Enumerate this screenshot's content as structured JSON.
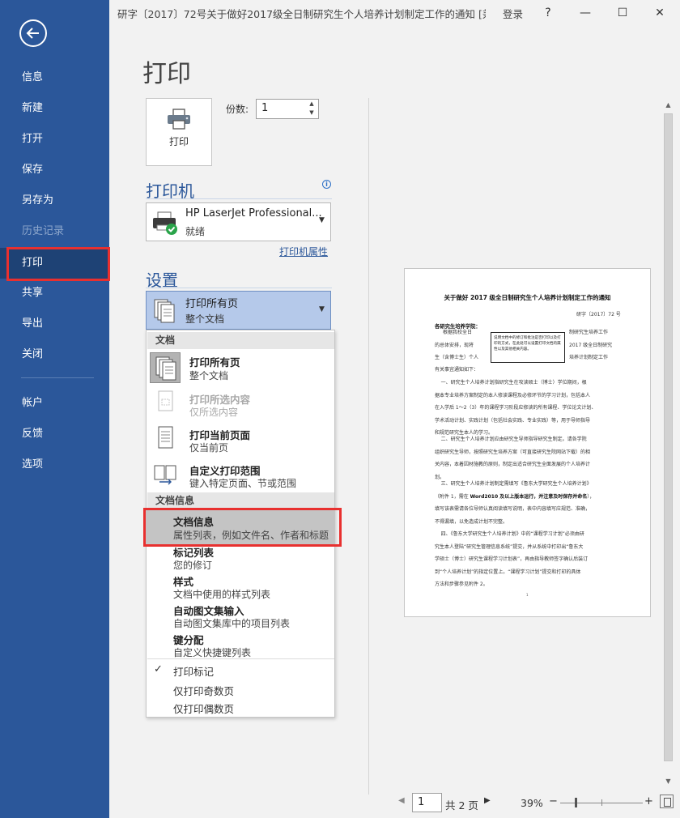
{
  "window": {
    "doc_title": "研字〔2017〕72号关于做好2017级全日制研究生个人培养计划制定工作的通知 [兼...",
    "login": "登录",
    "help": "?",
    "minimize": "—",
    "restore": "☐",
    "close": "✕"
  },
  "sidebar": {
    "items": [
      {
        "label": "信息"
      },
      {
        "label": "新建"
      },
      {
        "label": "打开"
      },
      {
        "label": "保存"
      },
      {
        "label": "另存为"
      },
      {
        "label": "历史记录"
      },
      {
        "label": "打印"
      },
      {
        "label": "共享"
      },
      {
        "label": "导出"
      },
      {
        "label": "关闭"
      },
      {
        "label": "帐户"
      },
      {
        "label": "反馈"
      },
      {
        "label": "选项"
      }
    ]
  },
  "print": {
    "heading": "打印",
    "button_label": "打印",
    "copies_label": "份数:",
    "copies_value": "1"
  },
  "printer": {
    "heading": "打印机",
    "name": "HP LaserJet Professional...",
    "status": "就绪",
    "properties_link": "打印机属性"
  },
  "settings": {
    "heading": "设置",
    "selected_main": "打印所有页",
    "selected_sub": "整个文档"
  },
  "menu": {
    "group_document": "文档",
    "group_docinfo": "文档信息",
    "items_document": [
      {
        "title": "打印所有页",
        "subtitle": "整个文档"
      },
      {
        "title": "打印所选内容",
        "subtitle": "仅所选内容"
      },
      {
        "title": "打印当前页面",
        "subtitle": "仅当前页"
      },
      {
        "title": "自定义打印范围",
        "subtitle": "键入特定页面、节或范围"
      }
    ],
    "items_docinfo": [
      {
        "title": "文档信息",
        "subtitle": "属性列表，例如文件名、作者和标题"
      },
      {
        "title": "标记列表",
        "subtitle": "您的修订"
      },
      {
        "title": "样式",
        "subtitle": "文档中使用的样式列表"
      },
      {
        "title": "自动图文集输入",
        "subtitle": "自动图文集库中的项目列表"
      },
      {
        "title": "键分配",
        "subtitle": "自定义快捷键列表"
      }
    ],
    "options": [
      {
        "label": "打印标记"
      },
      {
        "label": "仅打印奇数页"
      },
      {
        "label": "仅打印偶数页"
      }
    ],
    "check": "✓"
  },
  "preview": {
    "title": "关于做好 2017 级全日制研究生个人培养计划制定工作的通知",
    "doc_number": "研字〔2017〕72 号",
    "addressee": "各研究生培养学院：",
    "comment": "说明文档中的修订和批注是否打印以及打印的方式，在此处可以设置打印文档的属性以及其他相关内容。",
    "p1_l1": "根据我校全日",
    "p1_r1": "制研究生培养工作",
    "p1_l2": "的总体安排，现将",
    "p1_r2": "2017 级全日制研究",
    "p1_l3": "生（含博士生）个人",
    "p1_r3": "培养计划制定工作",
    "p1_l4": "有关事宜通知如下：",
    "p2": "    一、研究生个人培养计划指研究生在攻读硕士（博士）学位期间，根\n据本专业培养方案制定的本人修读课程及必修环节的学习计划，包括本人\n在入学后 1～2（3）年的课程学习阶段应修读的所有课程、学位论文计划、\n学术活动计划、实践计划（包括社会实践、专业实践）等，用于导师指导\n和规范研究生本人的学习。",
    "p3": "    二、研究生个人培养计划应由研究生导师指导研究生制定。请各学院\n组织研究生导师，按照研究生培养方案（可直接研究生院网站下载）的相\n关内容，本着因材施教的原则，制定出适合研究生全面发展的个人培养计\n划。",
    "p4_a": "    三、研究生个人培养计划制定需填写《鲁东大学研究生个人培养计划》\n（附件 1，需在 ",
    "p4_b": "Word2010 及以上版本运行，并注意及时保存并命名",
    "p4_c": "），\n填写该表需请各位导师认真阅读填写说明，表中内容填写应规范、准确，\n不得漏填，以免造成计划不完整。",
    "p5": "    四、《鲁东大学研究生个人培养计划》中的“课程学习计划”必须由研\n究生本人登陆“研究生管理信息系统”提交，并从系统中打印出“鲁东大\n学硕士（博士）研究生课程学习计划表”，再由指导教师签字确认后装订\n到“个人培养计划”的指定位置上。“课程学习计划”提交和打印的具体\n方法和步骤参见附件 2。",
    "page_number": "1"
  },
  "pagination": {
    "current_page": "1",
    "total": "共 2 页",
    "prev": "◀",
    "next": "▶"
  },
  "zoom": {
    "label": "39%",
    "minus": "−",
    "plus": "+",
    "level_percent": 39
  },
  "colors": {
    "sidebar": "#2b579a",
    "accent": "#2b579a",
    "highlight_box": "#e8302f",
    "selected_setting": "#b5c9ea"
  }
}
